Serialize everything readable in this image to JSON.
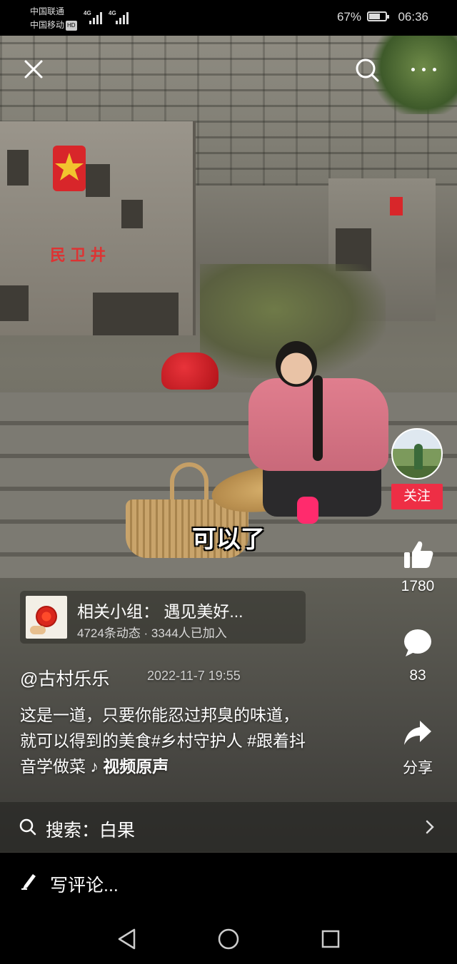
{
  "status_bar": {
    "carrier_1": "中国联通",
    "carrier_2": "中国移动",
    "hd_badge": "HD",
    "network_1": "4G",
    "network_2": "4G",
    "battery_percent": "67%",
    "battery_level": 0.67,
    "time": "06:36"
  },
  "video": {
    "subtitle": "可以了"
  },
  "top_controls": {
    "close_icon": "close-icon",
    "search_icon": "search-icon",
    "more_icon": "more-icon"
  },
  "right_rail": {
    "follow_label": "关注",
    "like_count": "1780",
    "comment_count": "83",
    "share_label": "分享"
  },
  "group": {
    "title": "相关小组： 遇见美好...",
    "subtitle": "4724条动态 · 3344人已加入"
  },
  "post": {
    "author": "@古村乐乐",
    "date": "2022-11-7 19:55",
    "desc_line_1": "这是一道，只要你能忍过邦臭的味道，",
    "desc_line_2_text": "就可以得到的美食",
    "tag_1": "#乡村守护人",
    "tag_2": "#跟着抖",
    "desc_line_3_text": "音学做菜",
    "music": "♪ 视频原声"
  },
  "search_strip": {
    "label": "搜索：白果"
  },
  "comment_bar": {
    "placeholder": "写评论..."
  },
  "colors": {
    "follow_red": "#ee2e45",
    "background": "#000000"
  }
}
